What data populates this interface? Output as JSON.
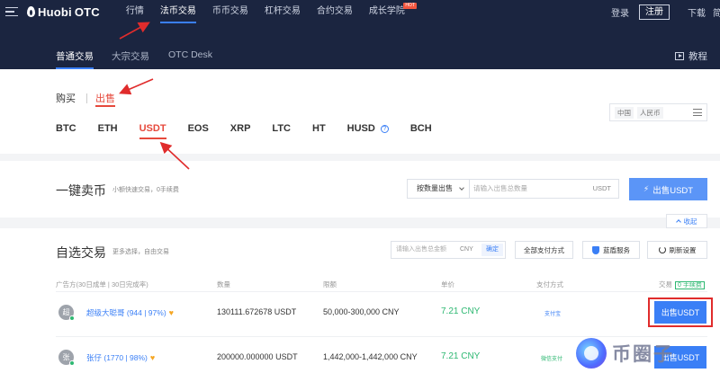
{
  "topnav": {
    "logo_text": "Huobi",
    "logo_suffix": "OTC",
    "items": [
      {
        "label": "行情",
        "active": false
      },
      {
        "label": "法币交易",
        "active": true
      },
      {
        "label": "币币交易",
        "active": false
      },
      {
        "label": "杠杆交易",
        "active": false
      },
      {
        "label": "合约交易",
        "active": false
      },
      {
        "label": "成长学院",
        "active": false,
        "badge": "HOT"
      }
    ],
    "login": "登录",
    "register": "注册",
    "download": "下载",
    "lang": "简"
  },
  "subnav": {
    "tabs": [
      {
        "label": "普通交易",
        "active": true
      },
      {
        "label": "大宗交易",
        "active": false
      },
      {
        "label": "OTC Desk",
        "active": false
      }
    ],
    "tutorial": "教程"
  },
  "filter": {
    "buy": "购买",
    "sell": "出售",
    "coins": [
      "BTC",
      "ETH",
      "USDT",
      "EOS",
      "XRP",
      "LTC",
      "HT",
      "HUSD",
      "BCH"
    ],
    "active_coin": "USDT",
    "region": "中国",
    "currency": "人民币"
  },
  "quick": {
    "title": "一键卖币",
    "subtitle": "小额快速交易，0手续费",
    "select_label": "按数量出售",
    "input_placeholder": "请输入出售总数量",
    "input_unit": "USDT",
    "button": "出售USDT",
    "collapse": "收起"
  },
  "market": {
    "title": "自选交易",
    "subtitle": "更多选择，自由交易",
    "amount_placeholder": "请输入出售总金额",
    "amount_unit": "CNY",
    "amount_ok": "确定",
    "payment_filter": "全部支付方式",
    "premium_service": "蓝盾服务",
    "refresh": "刷新设置",
    "headers": {
      "advertiser": "广告方(30日成单 | 30日完成率)",
      "quantity": "数量",
      "limit": "限额",
      "price": "单价",
      "payment": "支付方式",
      "trade": "交易",
      "zero_fee": "0 手续费"
    },
    "rows": [
      {
        "avatar": "超",
        "name": "超级大聪哥 (944 | 97%)",
        "quantity": "130111.672678 USDT",
        "limit": "50,000-300,000 CNY",
        "price": "7.21 CNY",
        "payment": "支付宝",
        "pay_color": "#3a7ff6",
        "action": "出售USDT"
      },
      {
        "avatar": "张",
        "name": "张仔 (1770 | 98%)",
        "quantity": "200000.000000 USDT",
        "limit": "1,442,000-1,442,000 CNY",
        "price": "7.21 CNY",
        "payment": "微信支付",
        "pay_color": "#2eb872",
        "action": "出售USDT"
      }
    ]
  },
  "watermark": "币圈子"
}
